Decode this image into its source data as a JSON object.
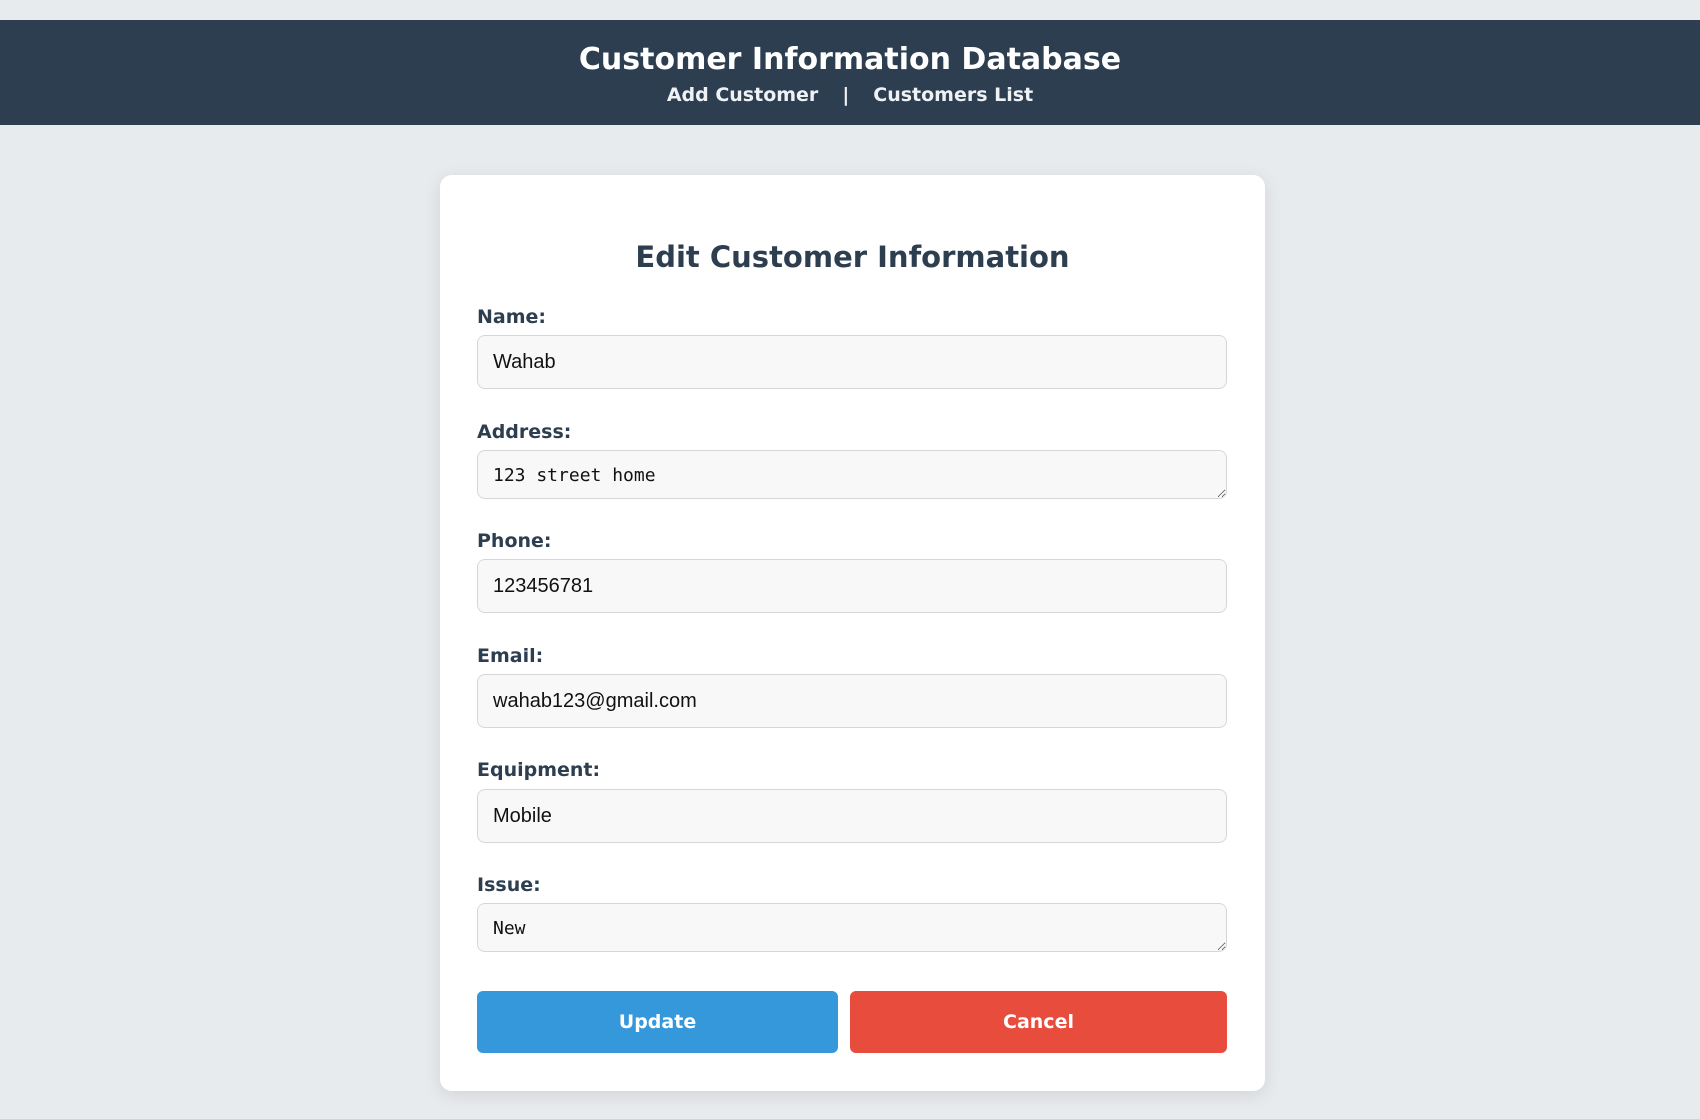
{
  "header": {
    "title": "Customer Information Database",
    "nav": {
      "add_customer": "Add Customer",
      "separator": "|",
      "customers_list": "Customers List"
    },
    "background_color": "#2c3e50"
  },
  "form": {
    "title": "Edit Customer Information",
    "fields": {
      "name": {
        "label": "Name:",
        "value": "Wahab"
      },
      "address": {
        "label": "Address:",
        "value": "123 street home"
      },
      "phone": {
        "label": "Phone:",
        "value": "123456781"
      },
      "email": {
        "label": "Email:",
        "value": "wahab123@gmail.com"
      },
      "equipment": {
        "label": "Equipment:",
        "value": "Mobile"
      },
      "issue": {
        "label": "Issue:",
        "value": "New"
      }
    },
    "buttons": {
      "update": "Update",
      "cancel": "Cancel"
    }
  },
  "colors": {
    "page_background": "#e8ebee",
    "update_button": "#3498db",
    "cancel_button": "#e74c3c",
    "text_dark": "#2c3e50"
  }
}
